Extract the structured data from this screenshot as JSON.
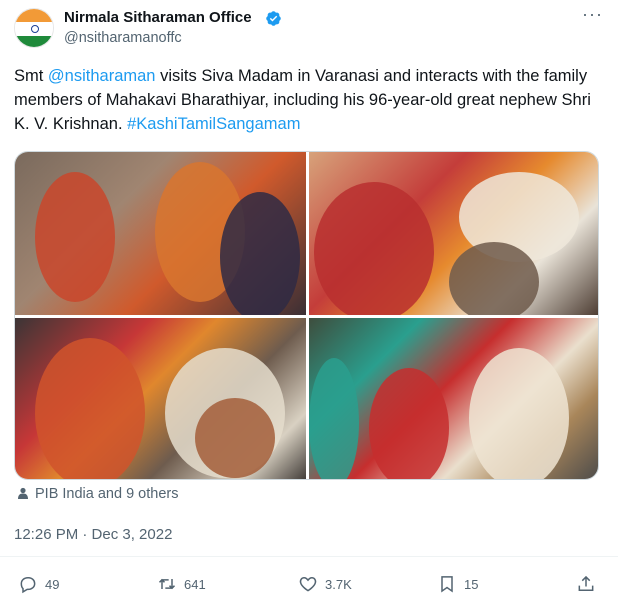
{
  "author": {
    "name": "Nirmala Sitharaman Office",
    "handle": "@nsitharamanoffc"
  },
  "menu": {
    "more_label": "···"
  },
  "tweet": {
    "prefix": "Smt ",
    "mention": "@nsitharaman",
    "body": " visits Siva Madam in Varanasi and interacts with the family members of Mahakavi Bharathiyar, including his 96-year-old great nephew Shri K. V. Krishnan. ",
    "hashtag": "#KashiTamilSangamam"
  },
  "tagged": {
    "text": "PIB India and 9 others"
  },
  "timestamp": "12:26 PM · Dec 3, 2022",
  "actions": {
    "replies": "49",
    "reposts": "641",
    "likes": "3.7K",
    "bookmarks": "15"
  },
  "colors": {
    "accent": "#1d9bf0",
    "text": "#0f1419",
    "muted": "#536471"
  },
  "icons": {
    "avatar": "india-flag-avatar",
    "verified": "verified-badge-icon",
    "tag": "person-tag-icon",
    "reply": "reply-icon",
    "repost": "repost-icon",
    "like": "heart-icon",
    "bookmark": "bookmark-icon",
    "share": "share-icon"
  }
}
